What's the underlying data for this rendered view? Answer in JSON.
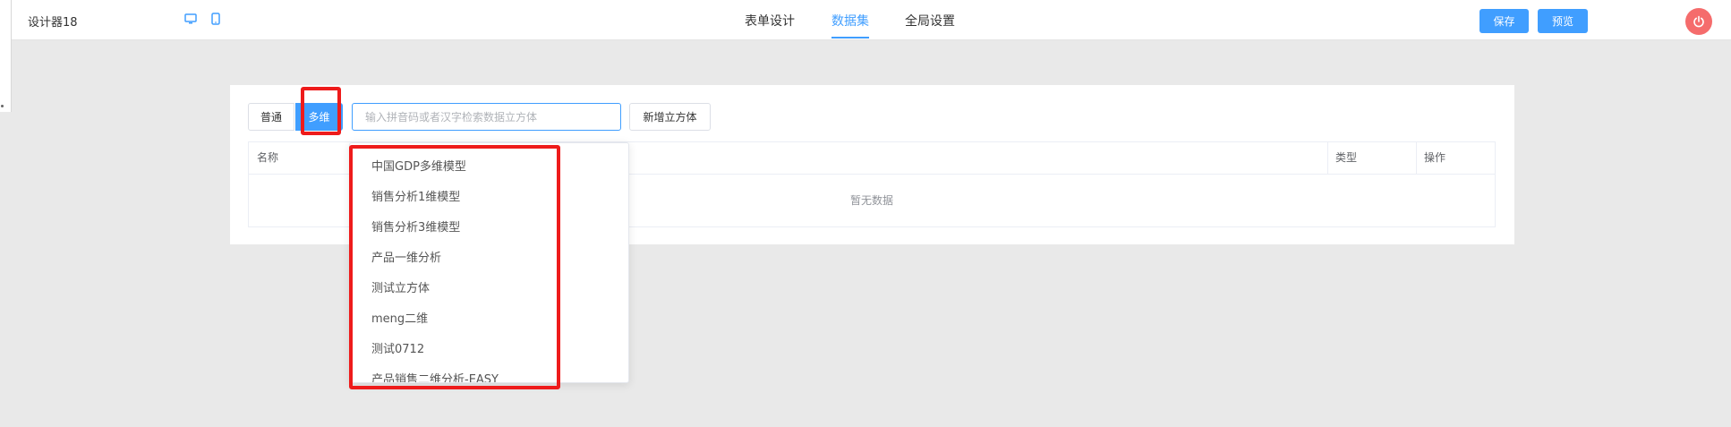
{
  "app": {
    "title": "设计器18"
  },
  "device_icons": [
    "desktop-icon",
    "mobile-icon"
  ],
  "nav": {
    "tabs": [
      {
        "label": "表单设计",
        "active": false
      },
      {
        "label": "数据集",
        "active": true
      },
      {
        "label": "全局设置",
        "active": false
      }
    ]
  },
  "toolbar": {
    "save_label": "保存",
    "preview_label": "预览",
    "power_icon": "power-icon"
  },
  "dataset": {
    "mode_buttons": [
      {
        "label": "普通",
        "active": false
      },
      {
        "label": "多维",
        "active": true
      }
    ],
    "search_placeholder": "输入拼音码或者汉字检索数据立方体",
    "search_value": "",
    "add_button_label": "新增立方体",
    "table": {
      "columns": [
        "名称",
        "类型",
        "操作"
      ],
      "empty_text": "暂无数据"
    },
    "dropdown_options": [
      "中国GDP多维模型",
      "销售分析1维模型",
      "销售分析3维模型",
      "产品一维分析",
      "测试立方体",
      "meng二维",
      "测试0712",
      "产品销售二维分析-EASY"
    ]
  },
  "colors": {
    "accent": "#409eff",
    "power": "#f56c6c",
    "highlight": "#ee1b1b",
    "background": "#e9e9e9"
  }
}
